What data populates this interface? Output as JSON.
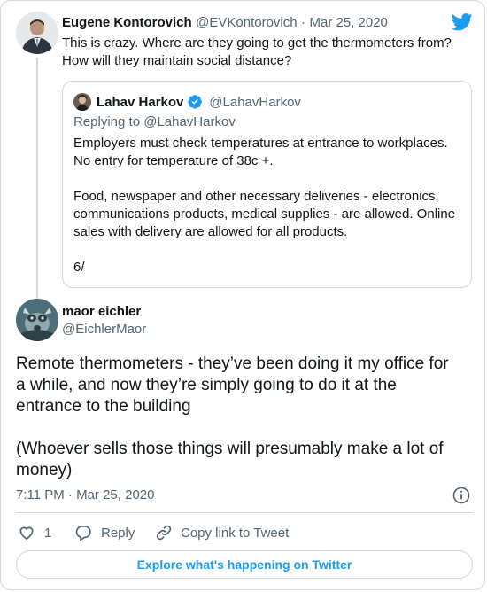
{
  "original_tweet": {
    "author_name": "Eugene Kontorovich",
    "handle": "@EVKontorovich",
    "separator": "·",
    "date": "Mar 25, 2020",
    "text_line1": "This is crazy. Where are they going to get the thermometers from?",
    "text_line2": "How will they maintain social distance?"
  },
  "quoted_tweet": {
    "author_name": "Lahav Harkov",
    "handle": "@LahavHarkov",
    "replying_to": "Replying to @LahavHarkov",
    "lines": [
      "Employers must check temperatures at entrance to workplaces.",
      "No entry for temperature of 38c +.",
      "Food, newspaper and other necessary deliveries - electronics,",
      "communications products, medical supplies - are allowed. Online",
      "sales with delivery are allowed for all products.",
      "6/"
    ]
  },
  "main_tweet": {
    "author_name": "maor eichler",
    "handle": "@EichlerMaor",
    "text": "Remote thermometers - they’ve been doing it my office for\na while, and now they’re simply going to do it at the\nentrance to the building\n\n(Whoever sells those things will presumably make a lot of\nmoney)",
    "timestamp": "7:11 PM · Mar 25, 2020"
  },
  "actions": {
    "like_count": "1",
    "reply_label": "Reply",
    "copy_link_label": "Copy link to Tweet"
  },
  "explore_label": "Explore what's happening on Twitter",
  "colors": {
    "twitter_blue": "#1d9bf0",
    "verified_blue": "#1d9bf0",
    "text_primary": "#0f1419",
    "text_secondary": "#536471",
    "border": "#cfd9de"
  },
  "icons": [
    "twitter-bird-icon",
    "verified-badge-icon",
    "info-icon",
    "heart-icon",
    "reply-icon",
    "link-icon"
  ]
}
